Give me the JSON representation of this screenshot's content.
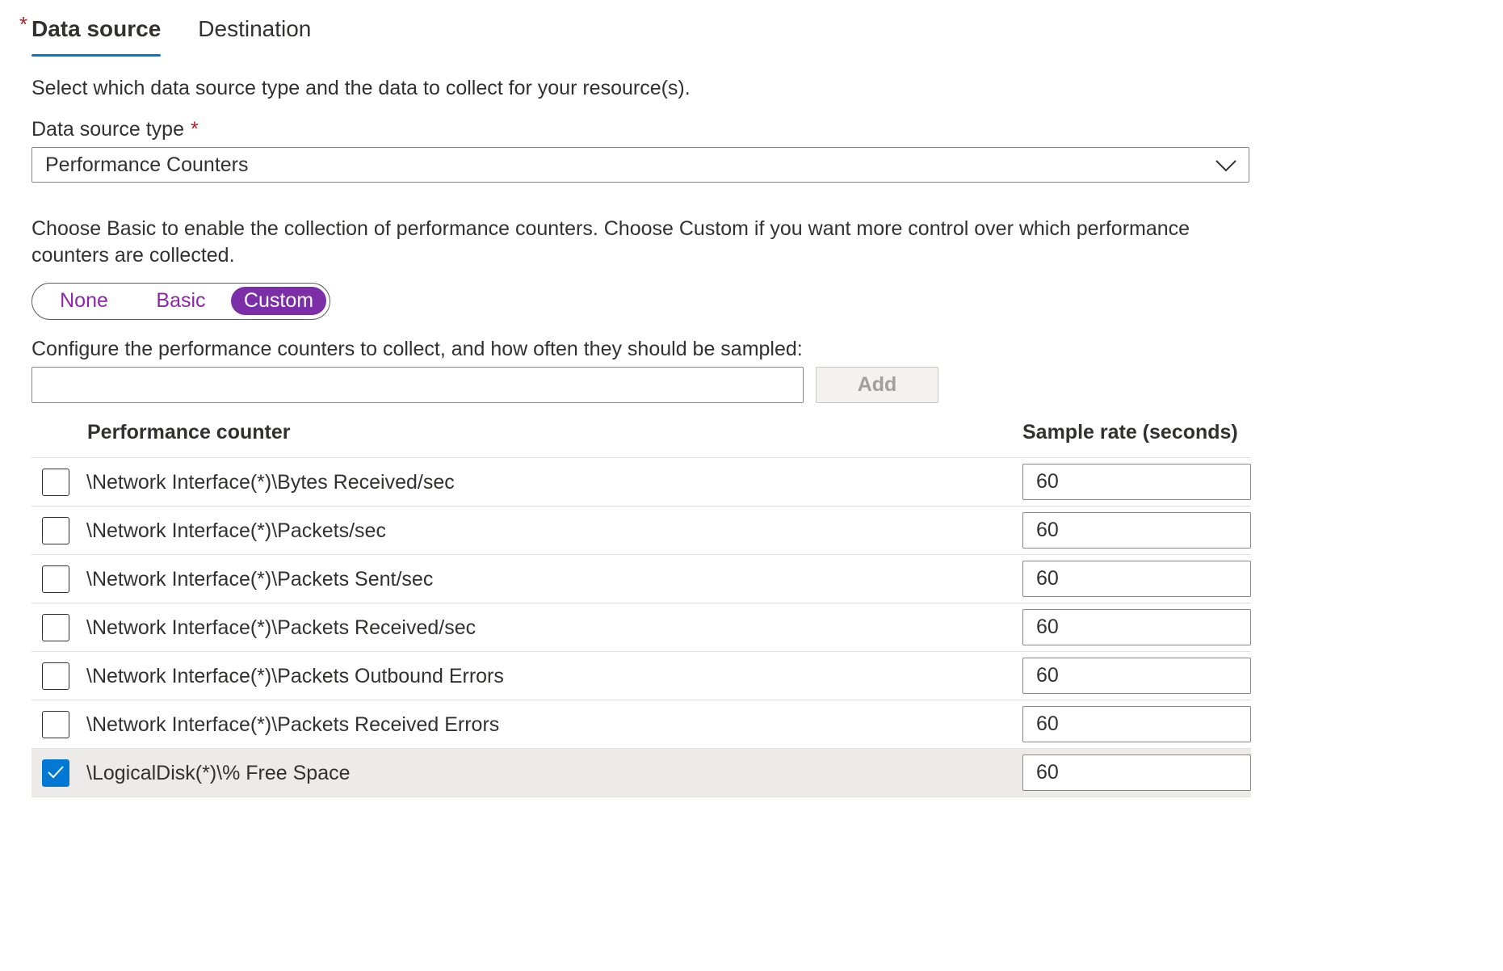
{
  "tabs": [
    {
      "label": "Data source",
      "required": true,
      "active": true
    },
    {
      "label": "Destination",
      "active": false
    }
  ],
  "intro_text": "Select which data source type and the data to collect for your resource(s).",
  "data_source_type": {
    "label": "Data source type",
    "required_marker": "*",
    "value": "Performance Counters"
  },
  "description": "Choose Basic to enable the collection of performance counters. Choose Custom if you want more control over which performance counters are collected.",
  "collection_mode": {
    "options": [
      "None",
      "Basic",
      "Custom"
    ],
    "selected": "Custom"
  },
  "configure_label": "Configure the performance counters to collect, and how often they should be sampled:",
  "add_counter": {
    "value": "",
    "add_label": "Add"
  },
  "table": {
    "headers": {
      "counter": "Performance counter",
      "rate": "Sample rate (seconds)"
    },
    "rows": [
      {
        "counter": "\\Network Interface(*)\\Bytes Received/sec",
        "rate": "60",
        "checked": false
      },
      {
        "counter": "\\Network Interface(*)\\Packets/sec",
        "rate": "60",
        "checked": false
      },
      {
        "counter": "\\Network Interface(*)\\Packets Sent/sec",
        "rate": "60",
        "checked": false
      },
      {
        "counter": "\\Network Interface(*)\\Packets Received/sec",
        "rate": "60",
        "checked": false
      },
      {
        "counter": "\\Network Interface(*)\\Packets Outbound Errors",
        "rate": "60",
        "checked": false
      },
      {
        "counter": "\\Network Interface(*)\\Packets Received Errors",
        "rate": "60",
        "checked": false
      },
      {
        "counter": "\\LogicalDisk(*)\\% Free Space",
        "rate": "60",
        "checked": true
      }
    ]
  },
  "colors": {
    "accent": "#0078d4",
    "toggle_active": "#7b2ea8",
    "toggle_text": "#8e24aa",
    "required": "#a4262c"
  },
  "icons": {
    "dropdown": "chevron-down-icon",
    "checkbox": "checkmark-icon"
  }
}
